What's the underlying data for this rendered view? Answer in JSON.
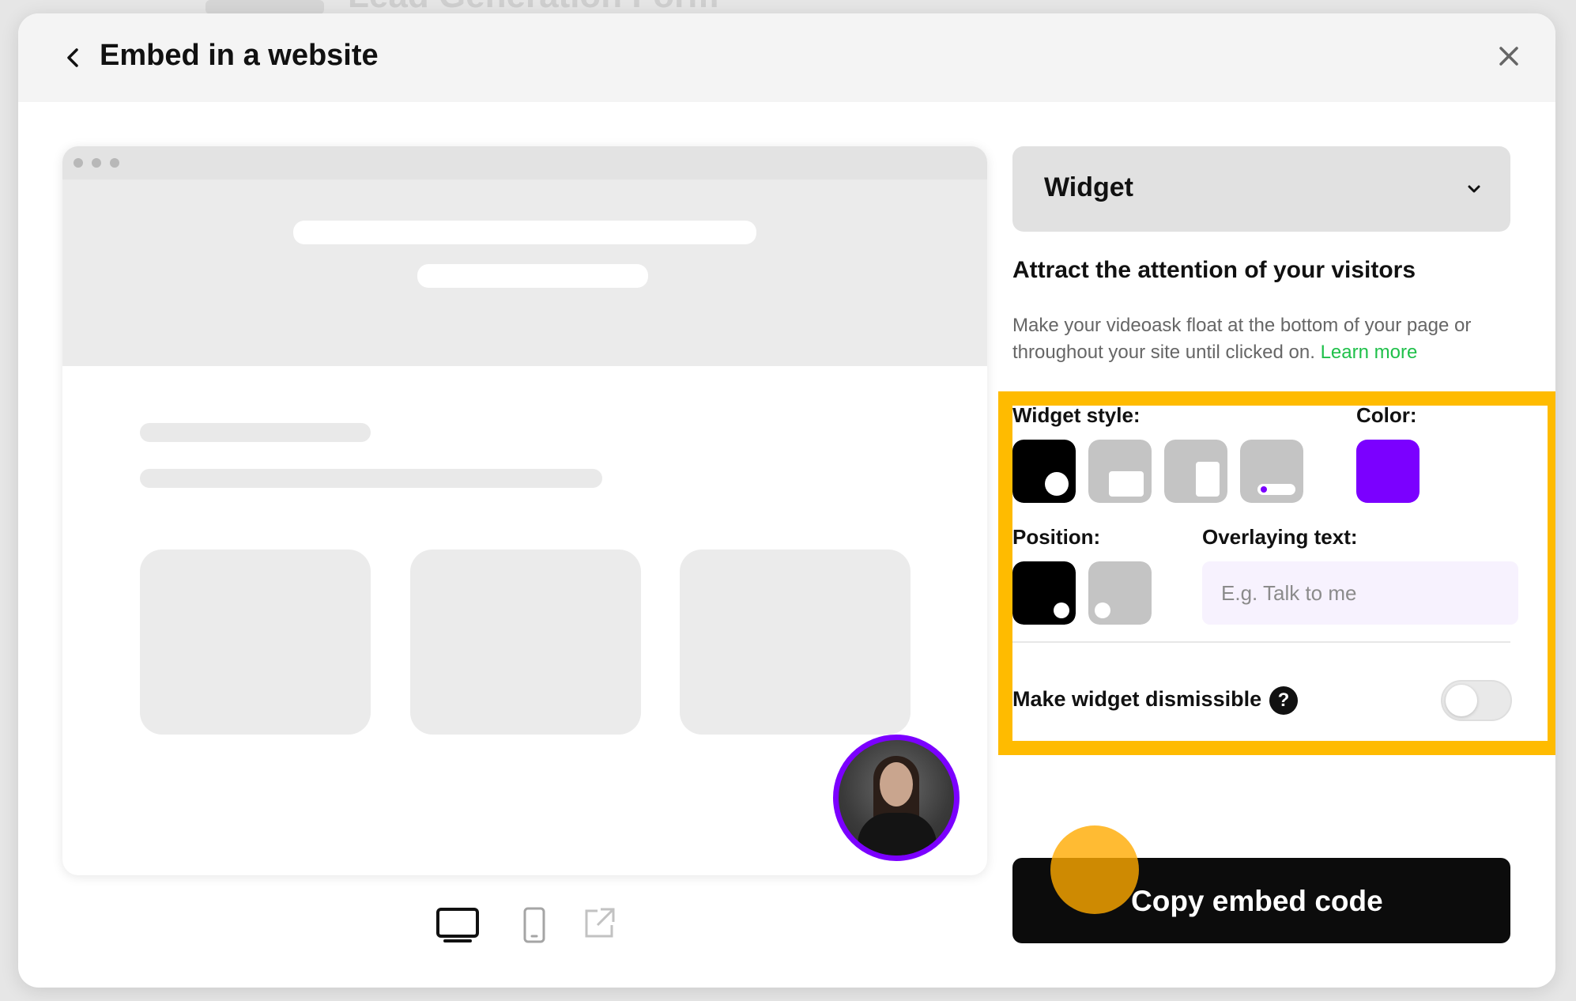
{
  "background": {
    "form_title": "Lead Generation Form"
  },
  "modal": {
    "title": "Embed in a website",
    "embed_type": "Widget",
    "heading": "Attract the attention of your visitors",
    "description": "Make your videoask float at the bottom of your page or throughout your site until clicked on.",
    "learn_more": "Learn more",
    "widget_style_label": "Widget style:",
    "color_label": "Color:",
    "position_label": "Position:",
    "overlaying_text_label": "Overlaying text:",
    "overlaying_text_placeholder": "E.g. Talk to me",
    "overlaying_text_value": "",
    "dismissible_label": "Make widget dismissible",
    "help_glyph": "?",
    "dismissible_enabled": false,
    "copy_button": "Copy embed code",
    "widget_color": "#7b00ff",
    "accent_link_color": "#1fc04a",
    "highlight_color": "#ffbb00",
    "selected_widget_style": "circle",
    "selected_position": "bottom-right"
  },
  "icons": {
    "back": "chevron-left-icon",
    "close": "close-icon",
    "dropdown": "chevron-down-icon",
    "devices": [
      "desktop-icon",
      "mobile-icon",
      "external-link-icon"
    ]
  }
}
